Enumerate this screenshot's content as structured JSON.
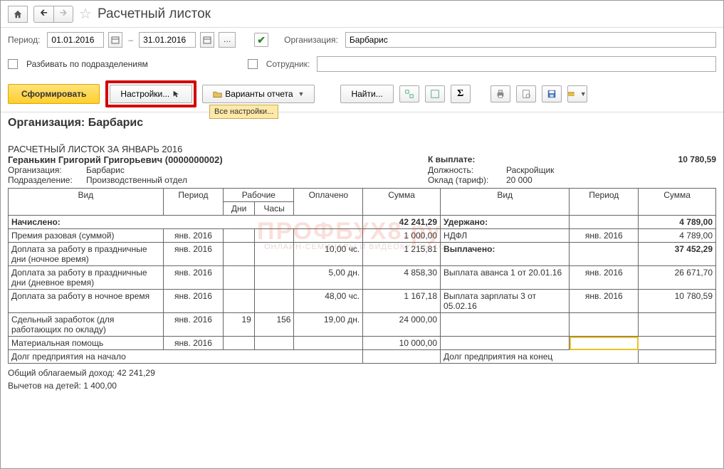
{
  "title": "Расчетный листок",
  "period": {
    "label": "Период:",
    "from": "01.01.2016",
    "sep": "–",
    "to": "31.01.2016"
  },
  "org": {
    "label": "Организация:",
    "value": "Барбарис"
  },
  "employee": {
    "label": "Сотрудник:",
    "value": ""
  },
  "split_by_dept": "Разбивать по подразделениям",
  "toolbar": {
    "generate": "Сформировать",
    "settings": "Настройки...",
    "report_variants": "Варианты отчета",
    "find": "Найти...",
    "all_settings_tooltip": "Все настройки..."
  },
  "report": {
    "org_header": "Организация: Барбарис",
    "sheet_title": "РАСЧЕТНЫЙ ЛИСТОК ЗА ЯНВАРЬ 2016",
    "employee_line": "Геранькин Григорий Григорьевич (0000000002)",
    "left_meta": [
      {
        "lab": "Организация:",
        "val": "Барбарис"
      },
      {
        "lab": "Подразделение:",
        "val": "Производственный отдел"
      }
    ],
    "right_meta": {
      "pay_label": "К выплате:",
      "pay_value": "10 780,59",
      "rows": [
        {
          "lab": "Должность:",
          "val": "Раскройщик"
        },
        {
          "lab": "Оклад (тариф):",
          "val": "20 000"
        }
      ]
    },
    "headers": {
      "vid": "Вид",
      "period": "Период",
      "rab": "Рабочие",
      "dni": "Дни",
      "chasy": "Часы",
      "opl": "Оплачено",
      "sum": "Сумма"
    },
    "left_section_label": "Начислено:",
    "left_section_sum": "42 241,29",
    "left_rows": [
      {
        "vid": "Премия разовая (суммой)",
        "period": "янв. 2016",
        "dni": "",
        "chasy": "",
        "opl": "",
        "sum": "1 000,00"
      },
      {
        "vid": "Доплата за работу в праздничные дни (ночное время)",
        "period": "янв. 2016",
        "dni": "",
        "chasy": "",
        "opl": "10,00 чс.",
        "sum": "1 215,81"
      },
      {
        "vid": "Доплата за работу в праздничные дни (дневное время)",
        "period": "янв. 2016",
        "dni": "",
        "chasy": "",
        "opl": "5,00 дн.",
        "sum": "4 858,30"
      },
      {
        "vid": "Доплата за работу в ночное время",
        "period": "янв. 2016",
        "dni": "",
        "chasy": "",
        "opl": "48,00 чс.",
        "sum": "1 167,18"
      },
      {
        "vid": "Сдельный заработок (для работающих по окладу)",
        "period": "янв. 2016",
        "dni": "19",
        "chasy": "156",
        "opl": "19,00 дн.",
        "sum": "24 000,00"
      },
      {
        "vid": "Материальная помощь",
        "period": "янв. 2016",
        "dni": "",
        "chasy": "",
        "opl": "",
        "sum": "10 000,00"
      }
    ],
    "right_sections": [
      {
        "label": "Удержано:",
        "sum": "4 789,00",
        "rows": [
          {
            "vid": "НДФЛ",
            "period": "янв. 2016",
            "sum": "4 789,00"
          }
        ]
      },
      {
        "label": "Выплачено:",
        "sum": "37 452,29",
        "rows": [
          {
            "vid": "Выплата аванса 1 от 20.01.16",
            "period": "янв. 2016",
            "sum": "26 671,70"
          },
          {
            "vid": "Выплата зарплаты 3 от 05.02.16",
            "period": "янв. 2016",
            "sum": "10 780,59"
          }
        ]
      }
    ],
    "debt_start": "Долг предприятия на начало",
    "debt_end": "Долг предприятия на конец",
    "footer": [
      "Общий облагаемый доход: 42 241,29",
      "Вычетов на детей: 1 400,00"
    ]
  }
}
